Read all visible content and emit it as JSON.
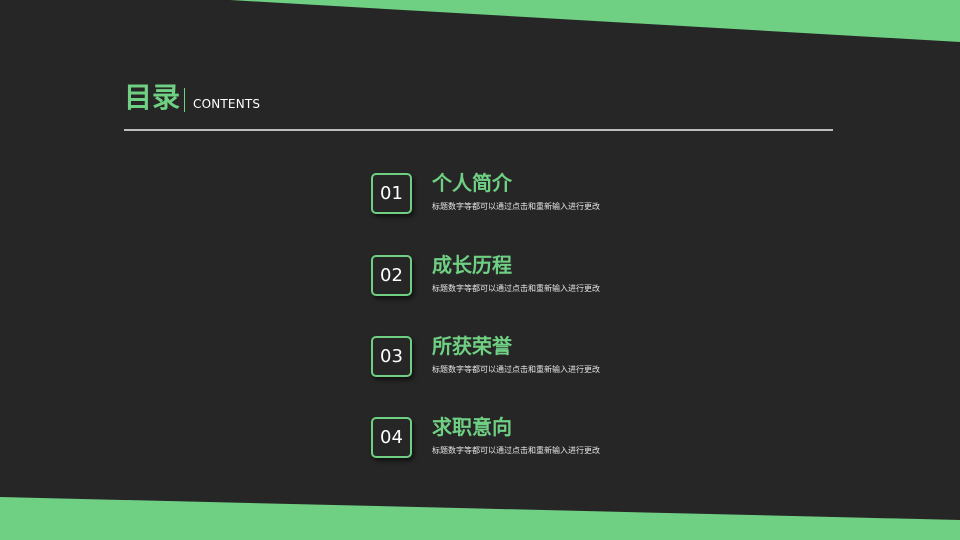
{
  "colors": {
    "background": "#262626",
    "accent": "#6fcf83",
    "rule": "#bdbdbd",
    "text": "#ffffff"
  },
  "header": {
    "title": "目录",
    "subtitle": "CONTENTS"
  },
  "toc": {
    "items": [
      {
        "number": "01",
        "title": "个人简介",
        "description": "标题数字等都可以通过点击和重新输入进行更改"
      },
      {
        "number": "02",
        "title": "成长历程",
        "description": "标题数字等都可以通过点击和重新输入进行更改"
      },
      {
        "number": "03",
        "title": "所获荣誉",
        "description": "标题数字等都可以通过点击和重新输入进行更改"
      },
      {
        "number": "04",
        "title": "求职意向",
        "description": "标题数字等都可以通过点击和重新输入进行更改"
      }
    ]
  }
}
